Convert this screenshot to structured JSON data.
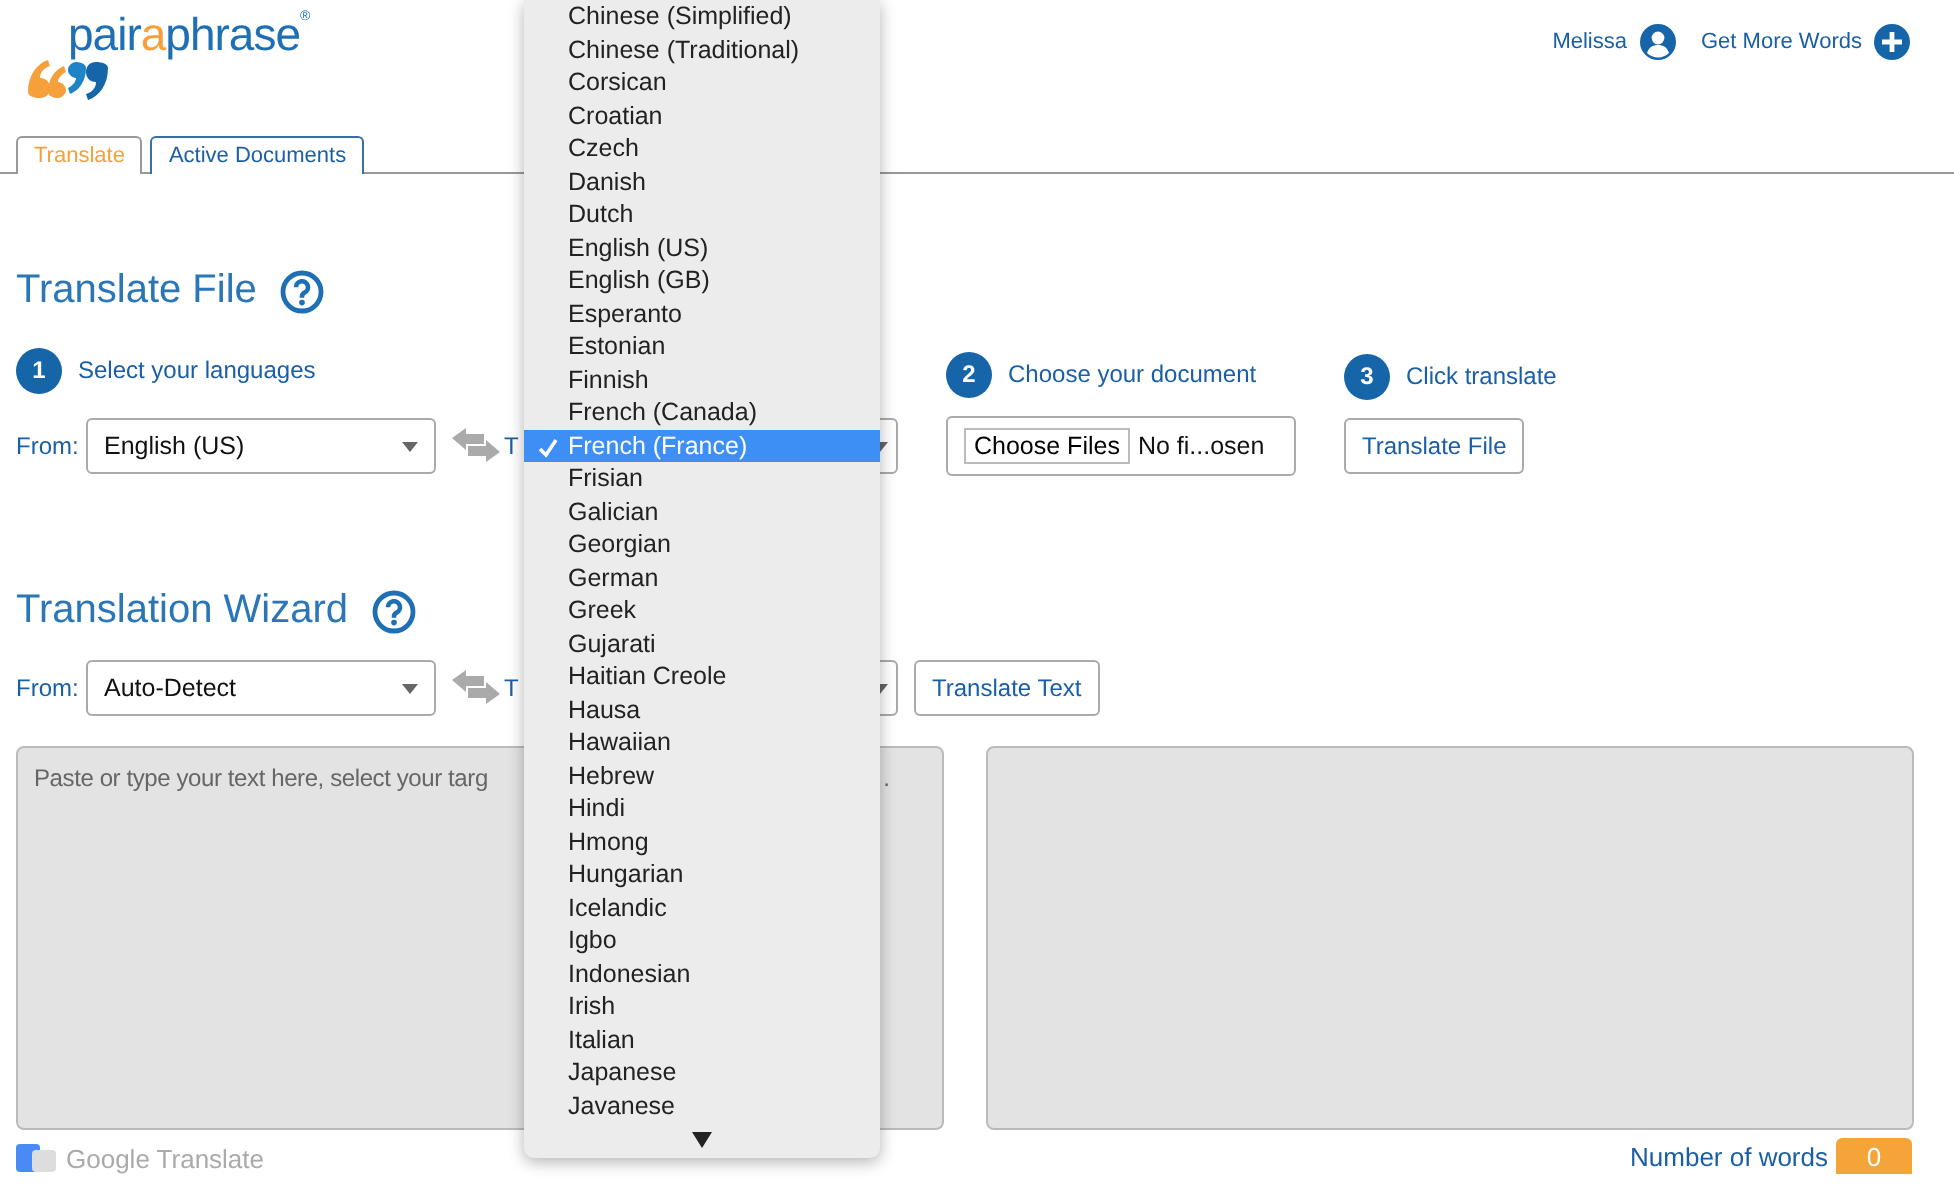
{
  "logo": {
    "parts": [
      {
        "text": "pair",
        "color": "#1f6fb5"
      },
      {
        "text": "a",
        "color": "#f5a03a"
      },
      {
        "text": "phrase",
        "color": "#1f6fb5"
      }
    ],
    "mark": "®"
  },
  "header_links": [
    {
      "label": "Melissa",
      "kind": "user"
    },
    {
      "label": "Get More Words",
      "kind": "plus"
    }
  ],
  "tabs": [
    {
      "label": "Translate",
      "selected": true
    },
    {
      "label": "Active Documents",
      "selected": false
    }
  ],
  "translate_file": {
    "title": "Translate File",
    "steps": [
      {
        "number": "1",
        "label": "Select your languages"
      },
      {
        "number": "2",
        "label": "Choose your document"
      },
      {
        "number": "3",
        "label": "Click translate"
      }
    ],
    "from_label": "From:",
    "from_value": "English (US)",
    "to_label": "T",
    "file_button": "Choose Files",
    "file_status": "No fi...osen",
    "action": "Translate File"
  },
  "wizard": {
    "title": "Translation Wizard",
    "from_label": "From:",
    "from_value": "Auto-Detect",
    "to_label": "T",
    "action": "Translate Text",
    "source_placeholder": "Paste or type your text here, select your targ",
    "source_tail": ".",
    "powered_by": "Google Translate",
    "word_count_label": "Number of words",
    "word_count": "0"
  },
  "language_menu": {
    "items": [
      {
        "label": "Chinese (Simplified)",
        "selected": false
      },
      {
        "label": "Chinese (Traditional)",
        "selected": false
      },
      {
        "label": "Corsican",
        "selected": false
      },
      {
        "label": "Croatian",
        "selected": false
      },
      {
        "label": "Czech",
        "selected": false
      },
      {
        "label": "Danish",
        "selected": false
      },
      {
        "label": "Dutch",
        "selected": false
      },
      {
        "label": "English (US)",
        "selected": false
      },
      {
        "label": "English (GB)",
        "selected": false
      },
      {
        "label": "Esperanto",
        "selected": false
      },
      {
        "label": "Estonian",
        "selected": false
      },
      {
        "label": "Finnish",
        "selected": false
      },
      {
        "label": "French (Canada)",
        "selected": false
      },
      {
        "label": "French (France)",
        "selected": true
      },
      {
        "label": "Frisian",
        "selected": false
      },
      {
        "label": "Galician",
        "selected": false
      },
      {
        "label": "Georgian",
        "selected": false
      },
      {
        "label": "German",
        "selected": false
      },
      {
        "label": "Greek",
        "selected": false
      },
      {
        "label": "Gujarati",
        "selected": false
      },
      {
        "label": "Haitian Creole",
        "selected": false
      },
      {
        "label": "Hausa",
        "selected": false
      },
      {
        "label": "Hawaiian",
        "selected": false
      },
      {
        "label": "Hebrew",
        "selected": false
      },
      {
        "label": "Hindi",
        "selected": false
      },
      {
        "label": "Hmong",
        "selected": false
      },
      {
        "label": "Hungarian",
        "selected": false
      },
      {
        "label": "Icelandic",
        "selected": false
      },
      {
        "label": "Igbo",
        "selected": false
      },
      {
        "label": "Indonesian",
        "selected": false
      },
      {
        "label": "Irish",
        "selected": false
      },
      {
        "label": "Italian",
        "selected": false
      },
      {
        "label": "Japanese",
        "selected": false
      },
      {
        "label": "Javanese",
        "selected": false
      }
    ]
  }
}
